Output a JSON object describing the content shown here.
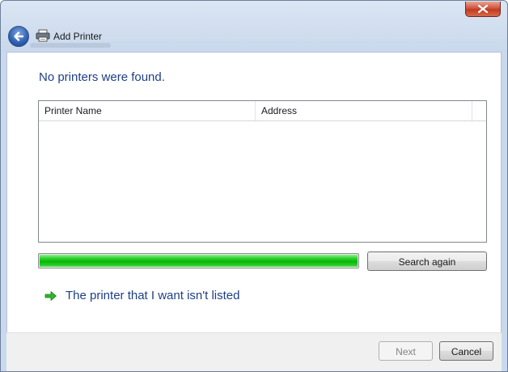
{
  "window": {
    "title": "Add Printer",
    "icons": {
      "back": "back-arrow-icon",
      "close": "close-icon",
      "printer": "printer-icon"
    }
  },
  "main": {
    "heading": "No printers were found.",
    "list": {
      "columns": [
        "Printer Name",
        "Address"
      ],
      "rows": []
    },
    "search_progress": 1.0,
    "search_again_label": "Search again",
    "not_listed_link": "The printer that I want isn't listed"
  },
  "footer": {
    "next_label": "Next",
    "next_enabled": false,
    "cancel_label": "Cancel"
  },
  "colors": {
    "heading": "#1e3f85",
    "progress_fill": "#08b808",
    "close_button": "#c23a20"
  }
}
